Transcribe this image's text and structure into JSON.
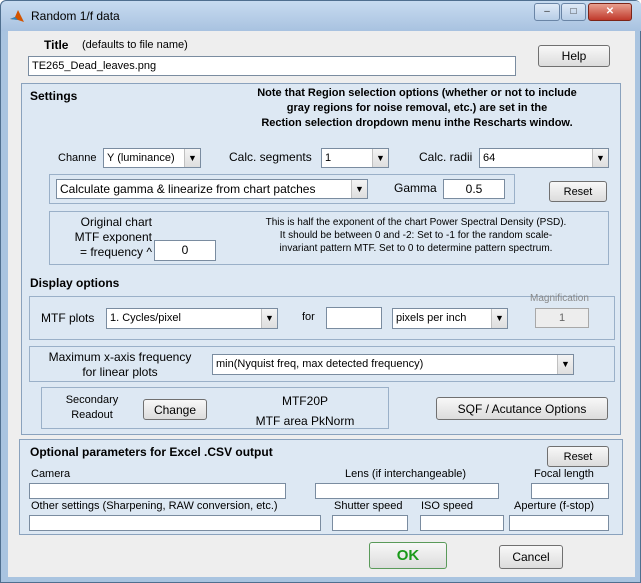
{
  "window": {
    "title": "Random 1/f data",
    "minimize_glyph": "–",
    "maximize_glyph": "□",
    "close_glyph": "✕"
  },
  "title_section": {
    "label": "Title",
    "hint": "(defaults to file name)",
    "value": "TE265_Dead_leaves.png",
    "help_label": "Help"
  },
  "settings": {
    "heading": "Settings",
    "note_line1": "Note that Region selection options (whether or not to include",
    "note_line2": "gray regions for noise removal, etc.) are set in the",
    "note_line3": "Rection selection dropdown menu inthe Rescharts window.",
    "channel_label": "Channe",
    "channel_value": "Y (luminance)",
    "segments_label": "Calc. segments",
    "segments_value": "1",
    "radii_label": "Calc. radii",
    "radii_value": "64",
    "gamma_mode_value": "Calculate gamma & linearize from chart patches",
    "gamma_label": "Gamma",
    "gamma_value": "0.5",
    "reset_label": "Reset",
    "mtf_exp_line1": "Original chart",
    "mtf_exp_line2": "MTF exponent",
    "mtf_exp_line3": "= frequency ^",
    "mtf_exp_value": "0",
    "mtf_note_line1": "This is half the exponent of the chart Power Spectral Density (PSD).",
    "mtf_note_line2": "It should be between 0 and -2: Set to -1 for the random scale-",
    "mtf_note_line3": "invariant pattern MTF. Set to 0 to determine pattern spectrum."
  },
  "display": {
    "heading": "Display options",
    "mtf_plots_label": "MTF plots",
    "mtf_plots_value": "1. Cycles/pixel",
    "for_label": "for",
    "for_value": "",
    "units_value": "pixels per inch",
    "magnification_label": "Magnification",
    "magnification_value": "1",
    "maxfreq_line1": "Maximum x-axis frequency",
    "maxfreq_line2": "for linear plots",
    "maxfreq_value": "min(Nyquist freq, max detected frequency)",
    "secondary_line1": "Secondary",
    "secondary_line2": "Readout",
    "change_label": "Change",
    "readout_line1": "MTF20P",
    "readout_line2": "MTF area PkNorm",
    "sqf_label": "SQF / Acutance Options"
  },
  "optional": {
    "heading": "Optional parameters  for Excel .CSV output",
    "reset_label": "Reset",
    "camera_label": "Camera",
    "lens_label": "Lens (if interchangeable)",
    "focal_label": "Focal length",
    "other_label": "Other settings (Sharpening, RAW conversion, etc.)",
    "shutter_label": "Shutter speed",
    "iso_label": "ISO speed",
    "aperture_label": "Aperture (f-stop)"
  },
  "footer": {
    "ok_label": "OK",
    "cancel_label": "Cancel"
  },
  "colors": {
    "ok_text": "#1a9a1a",
    "panel_bg": "#dde8f3"
  }
}
